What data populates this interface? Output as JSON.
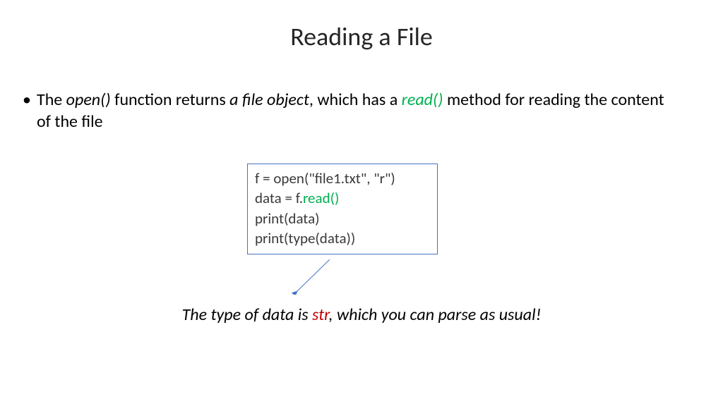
{
  "title": "Reading a File",
  "bullet": {
    "marker": "•",
    "p1": "The ",
    "p2": "open()",
    "p3": " function returns ",
    "p4": "a file object",
    "p5": ", which has a ",
    "p6": "read()",
    "p7": " method for reading the content of the file"
  },
  "code": {
    "l1": "f = open(\"file1.txt\", \"r\")",
    "l2a": "data = f.",
    "l2b": "read()",
    "l3": "print(data)",
    "l4": "print(type(data))"
  },
  "caption": {
    "c1": "The type of data is ",
    "c2": "str",
    "c3": ", which you can parse as usual!"
  },
  "colors": {
    "green": "#00B050",
    "red": "#C00000",
    "border": "#4472C4"
  }
}
